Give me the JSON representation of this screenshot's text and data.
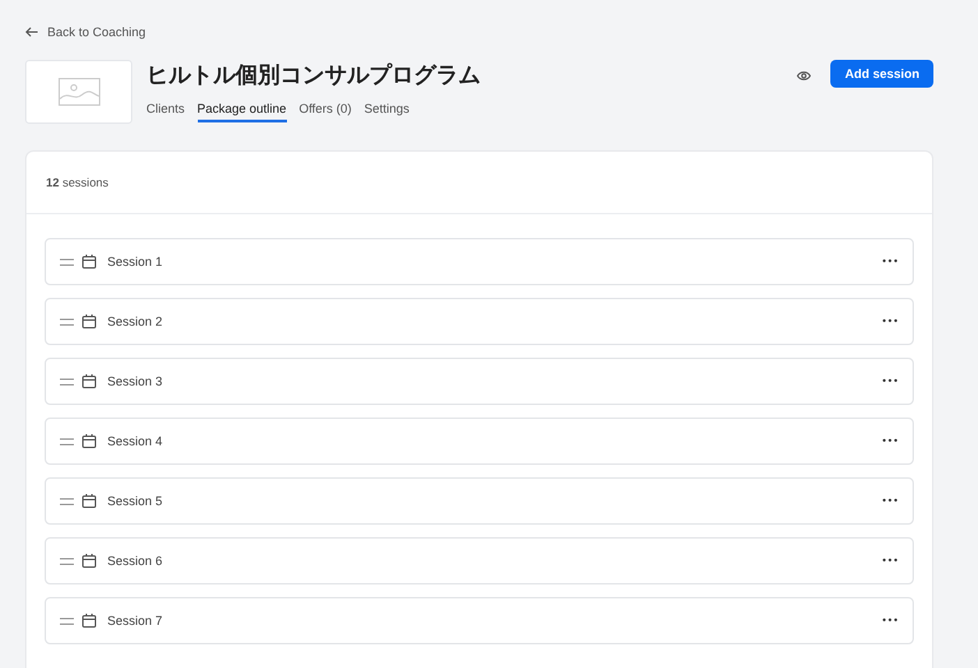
{
  "back_link": "Back to Coaching",
  "title": "ヒルトル個別コンサルプログラム",
  "tabs": [
    {
      "label": "Clients",
      "selected": false
    },
    {
      "label": "Package outline",
      "selected": true
    },
    {
      "label": "Offers (0)",
      "selected": false
    },
    {
      "label": "Settings",
      "selected": false
    }
  ],
  "add_button": "Add session",
  "session_count": "**12** sessions",
  "sessions": [
    {
      "name": "Session 1",
      "menu": "•••"
    },
    {
      "name": "Session 2",
      "menu": "•••"
    },
    {
      "name": "Session 3",
      "menu": "•••"
    },
    {
      "name": "Session 4",
      "menu": "•••"
    },
    {
      "name": "Session 5",
      "menu": "•••"
    },
    {
      "name": "Session 6",
      "menu": "•••"
    },
    {
      "name": "Session 7",
      "menu": "•••"
    }
  ]
}
